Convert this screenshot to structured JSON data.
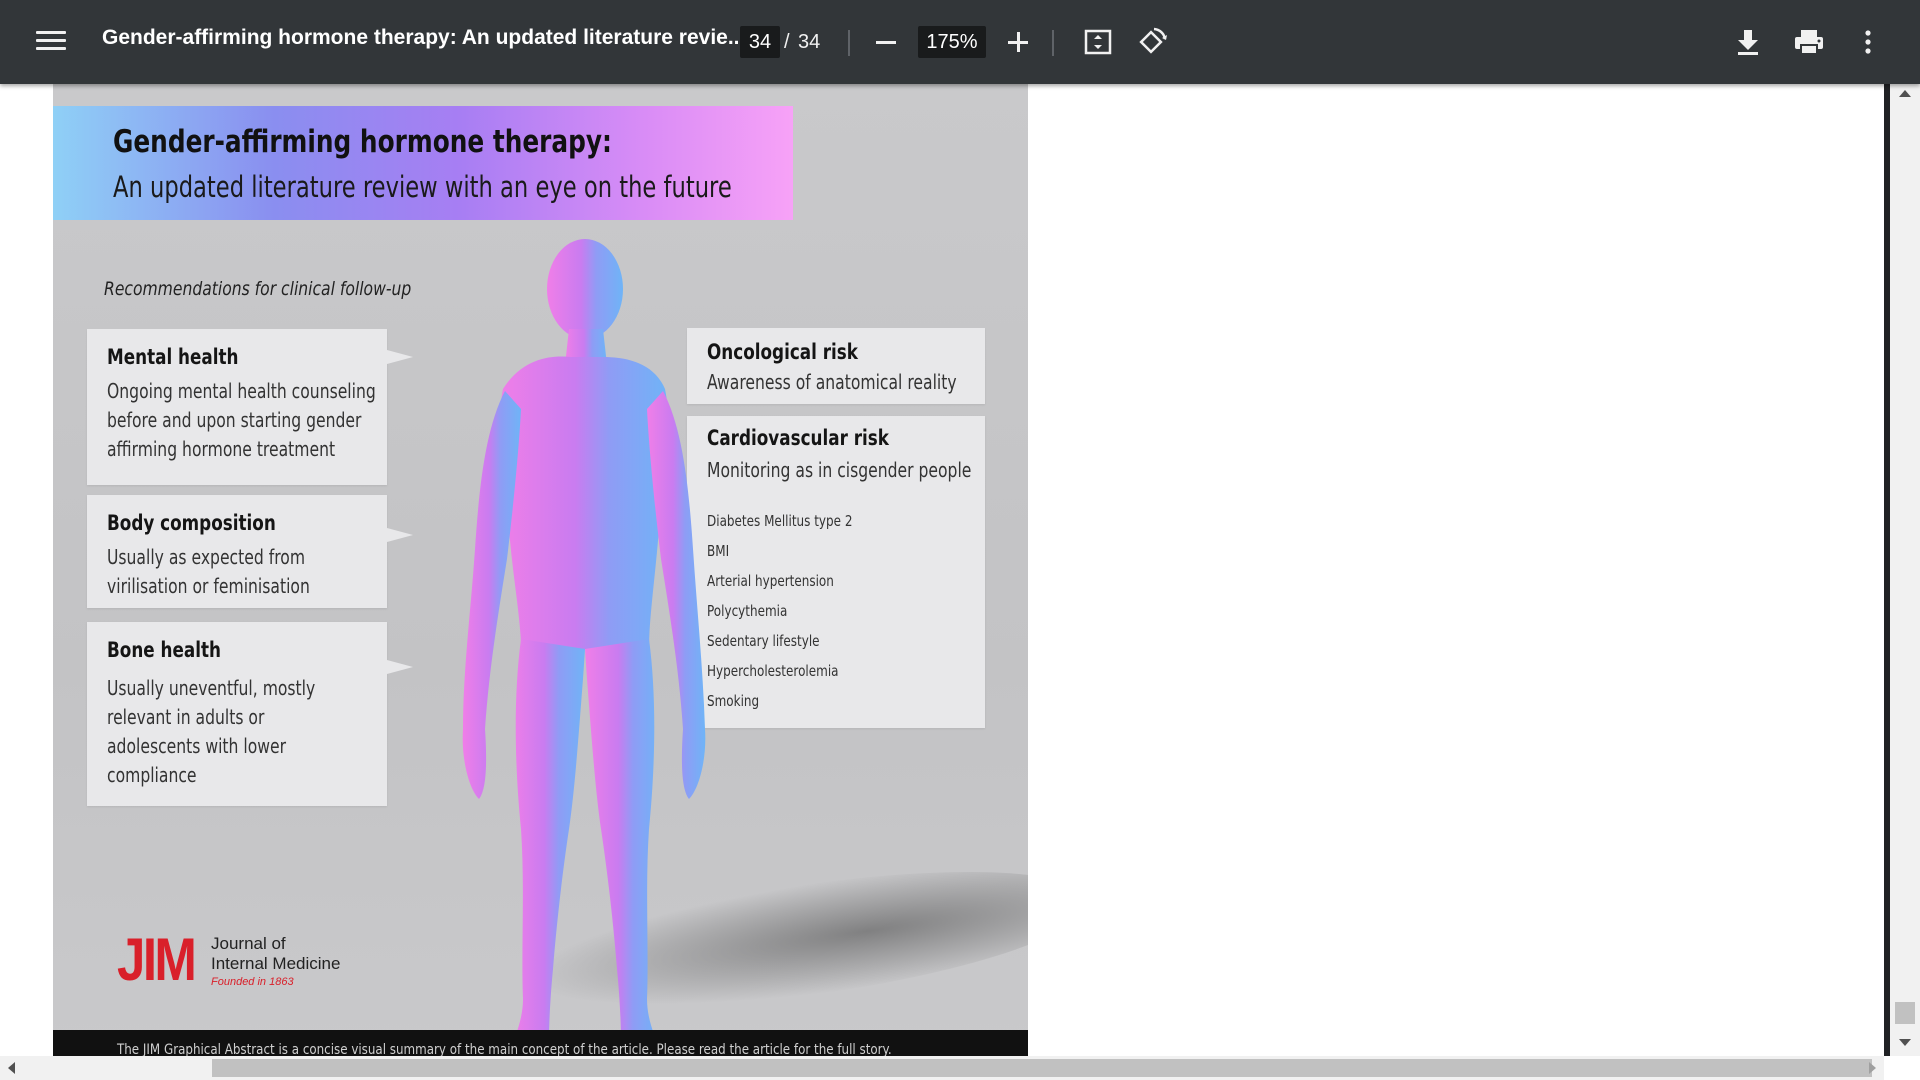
{
  "toolbar": {
    "title": "Gender-affirming hormone therapy: An updated literature revie...",
    "page_current": "34",
    "page_separator": "/",
    "page_total": "34",
    "zoom": "175%",
    "icons": [
      "menu-icon",
      "zoom-out-icon",
      "zoom-in-icon",
      "fit-to-page-icon",
      "rotate-icon",
      "download-icon",
      "print-icon",
      "more-vert-icon"
    ]
  },
  "document": {
    "banner_title": "Gender-affirming hormone therapy:",
    "banner_subtitle": "An updated literature review with an eye on the future",
    "rec_heading": "Recommendations for clinical follow-up",
    "cards": {
      "mental": {
        "title": "Mental health",
        "lines": [
          "Ongoing mental health counseling",
          "before and upon starting gender",
          "affirming hormone treatment"
        ]
      },
      "body": {
        "title": "Body composition",
        "lines": [
          "Usually as expected from",
          "virilisation or feminisation"
        ]
      },
      "bone": {
        "title": "Bone health",
        "lines": [
          "Usually uneventful, mostly",
          "relevant in adults or",
          "adolescents with lower",
          "compliance"
        ]
      },
      "onco": {
        "title": "Oncological risk",
        "lines": [
          "Awareness of anatomical reality"
        ]
      },
      "cardio": {
        "title": "Cardiovascular risk",
        "lines": [
          "Monitoring as in cisgender people"
        ],
        "items": [
          "Diabetes Mellitus type 2",
          "BMI",
          "Arterial hypertension",
          "Polycythemia",
          "Sedentary lifestyle",
          "Hypercholesterolemia",
          "Smoking"
        ]
      }
    },
    "logo": {
      "mark": "JIM",
      "line1": "Journal of",
      "line2": "Internal Medicine",
      "line3": "Founded in 1863"
    },
    "footer": "The JIM Graphical Abstract is a concise visual summary of the main concept of the article. Please read the article for the full story."
  },
  "colors": {
    "toolbar_bg": "#323639",
    "banner_gradient": [
      "#8fd0f6",
      "#a77ef3",
      "#f7a2f7"
    ],
    "logo_red": "#d9202a"
  }
}
